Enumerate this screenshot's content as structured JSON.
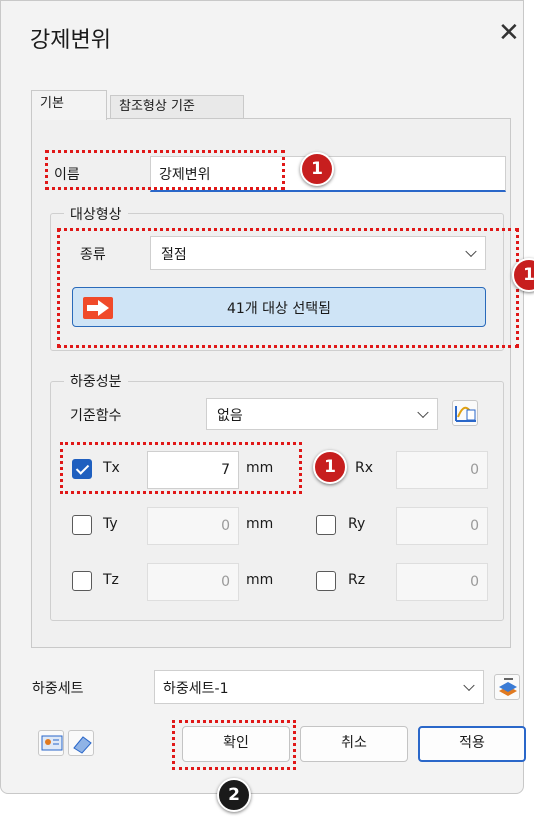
{
  "title": "강제변위",
  "tabs": [
    {
      "label": "기본"
    },
    {
      "label": "참조형상 기준"
    }
  ],
  "name_field": {
    "label": "이름",
    "value": "강제변위"
  },
  "target_group": {
    "legend": "대상형상",
    "type_label": "종류",
    "type_value": "절점",
    "select_button_label": "41개 대상 선택됨"
  },
  "load_group": {
    "legend": "하중성분",
    "base_function_label": "기준함수",
    "base_function_value": "없음",
    "components": [
      {
        "label": "Tx",
        "checked": true,
        "value": "7",
        "unit": "mm"
      },
      {
        "label": "Ty",
        "checked": false,
        "value": "0",
        "unit": "mm"
      },
      {
        "label": "Tz",
        "checked": false,
        "value": "0",
        "unit": "mm"
      },
      {
        "label": "Rx",
        "checked": false,
        "value": "0"
      },
      {
        "label": "Ry",
        "checked": false,
        "value": "0"
      },
      {
        "label": "Rz",
        "checked": false,
        "value": "0"
      }
    ]
  },
  "load_set": {
    "label": "하중세트",
    "value": "하중세트-1"
  },
  "buttons": {
    "ok": "확인",
    "cancel": "취소",
    "apply": "적용"
  },
  "badges": {
    "one": "1",
    "two": "2"
  },
  "colors": {
    "accent": "#2a67c9",
    "highlight": "#e01818",
    "select_fill": "#cfe4f6"
  }
}
